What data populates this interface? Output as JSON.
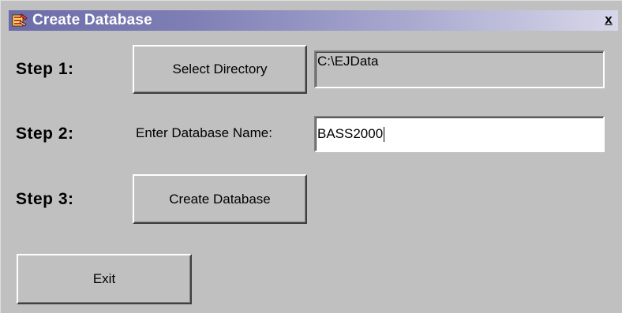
{
  "window": {
    "title": "Create Database",
    "close_label": "x",
    "icon": "database-app-icon"
  },
  "step1": {
    "label": "Step 1:",
    "button_label": "Select Directory",
    "directory_value": "C:\\EJData"
  },
  "step2": {
    "label": "Step 2:",
    "field_label": "Enter Database Name:",
    "database_name_value": "BASS2000"
  },
  "step3": {
    "label": "Step 3:",
    "button_label": "Create Database"
  },
  "footer": {
    "exit_label": "Exit"
  },
  "colors": {
    "dialog_face": "#c0c0c0",
    "titlebar_start": "#6c6ca8",
    "titlebar_end": "#d7d7ea",
    "title_text": "#ffffff"
  }
}
